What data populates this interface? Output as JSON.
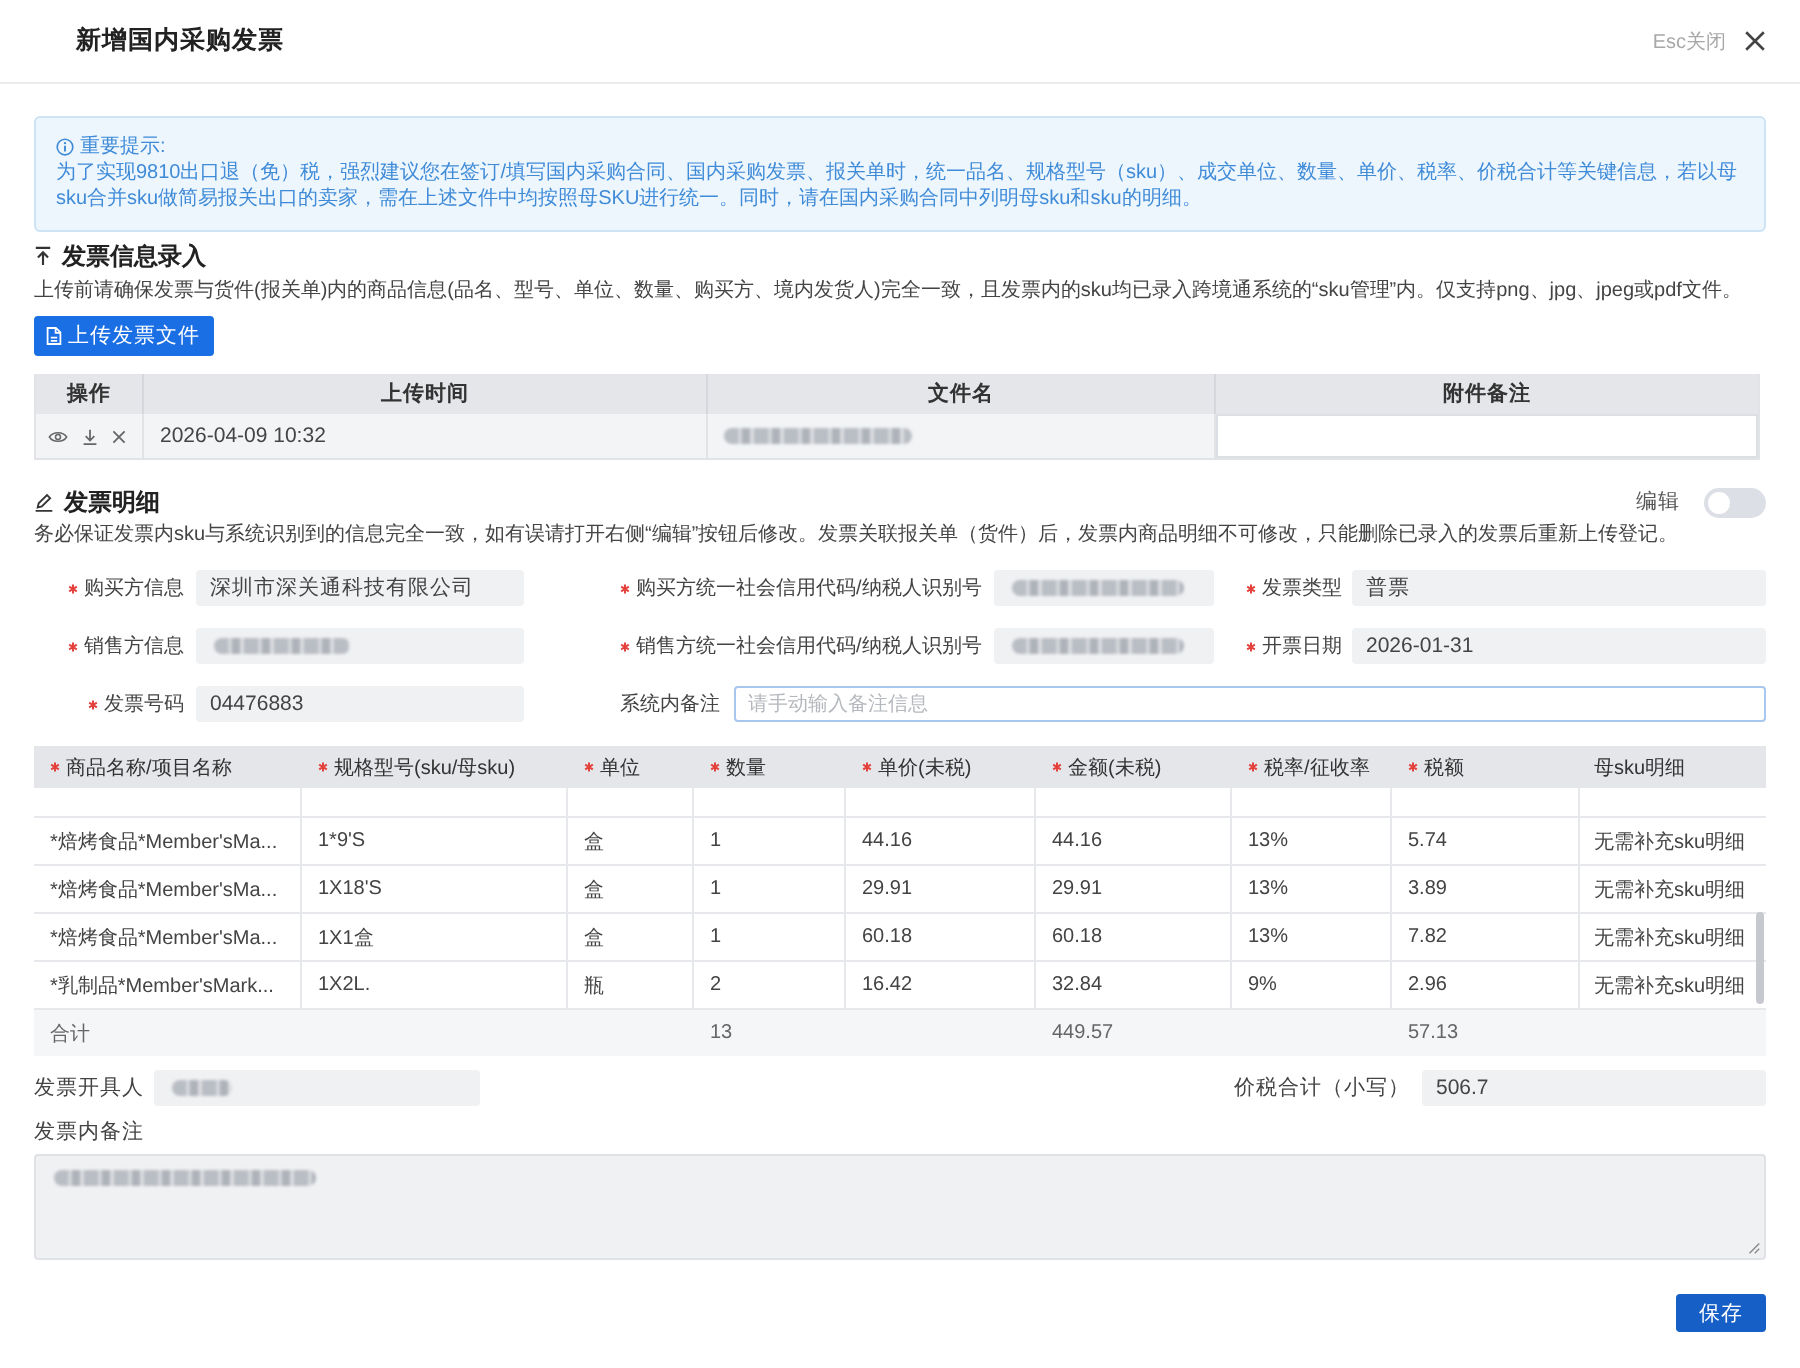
{
  "dialog": {
    "title": "新增国内采购发票",
    "close_hint": "Esc关闭"
  },
  "notice": {
    "title": "重要提示:",
    "text": "为了实现9810出口退（免）税，强烈建议您在签订/填写国内采购合同、国内采购发票、报关单时，统一品名、规格型号（sku）、成交单位、数量、单价、税率、价税合计等关键信息，若以母sku合并sku做简易报关出口的卖家，需在上述文件中均按照母SKU进行统一。同时，请在国内采购合同中列明母sku和sku的明细。"
  },
  "invoice_upload": {
    "heading": "发票信息录入",
    "description": "上传前请确保发票与货件(报关单)内的商品信息(品名、型号、单位、数量、购买方、境内发货人)完全一致，且发票内的sku均已录入跨境通系统的“sku管理”内。仅支持png、jpg、jpeg或pdf文件。",
    "upload_button": "上传发票文件",
    "table": {
      "columns": [
        "操作",
        "上传时间",
        "文件名",
        "附件备注"
      ],
      "rows": [
        {
          "upload_time": "2026-04-09 10:32",
          "file_name_blurred": true
        }
      ]
    }
  },
  "invoice_detail": {
    "heading": "发票明细",
    "edit_toggle": {
      "label": "编辑",
      "on": false
    },
    "description": "务必保证发票内sku与系统识别到的信息完全一致，如有误请打开右侧“编辑”按钮后修改。发票关联报关单（货件）后，发票内商品明细不可修改，只能删除已录入的发票后重新上传登记。",
    "field_rows": [
      {
        "fields": [
          {
            "kind": "readonly",
            "label": "购买方信息",
            "required": true,
            "value": "深圳市深关通科技有限公司"
          },
          {
            "kind": "readonly",
            "label": "购买方统一社会信用代码/纳税人识别号",
            "required": true,
            "blurred": true
          },
          {
            "kind": "readonly",
            "label": "发票类型",
            "required": true,
            "value": "普票"
          }
        ]
      },
      {
        "fields": [
          {
            "kind": "readonly",
            "label": "销售方信息",
            "required": true,
            "blurred": true
          },
          {
            "kind": "readonly",
            "label": "销售方统一社会信用代码/纳税人识别号",
            "required": true,
            "blurred": true
          },
          {
            "kind": "readonly",
            "label": "开票日期",
            "required": true,
            "value": "2026-01-31"
          }
        ]
      },
      {
        "fields": [
          {
            "kind": "readonly",
            "label": "发票号码",
            "required": true,
            "value": "04476883"
          },
          {
            "kind": "input",
            "label": "系统内备注",
            "required": false,
            "placeholder": "请手动输入备注信息"
          }
        ]
      }
    ],
    "items_table": {
      "columns": [
        {
          "label": "商品名称/项目名称",
          "required": true
        },
        {
          "label": "规格型号(sku/母sku)",
          "required": true
        },
        {
          "label": "单位",
          "required": true
        },
        {
          "label": "数量",
          "required": true
        },
        {
          "label": "单价(未税)",
          "required": true
        },
        {
          "label": "金额(未税)",
          "required": true
        },
        {
          "label": "税率/征收率",
          "required": true
        },
        {
          "label": "税额",
          "required": true
        },
        {
          "label": "母sku明细",
          "required": false
        }
      ],
      "rows": [
        {
          "cells": [
            "*焙烤食品*Member'sMa...",
            "1*9'S",
            "盒",
            "1",
            "44.16",
            "44.16",
            "13%",
            "5.74",
            "无需补充sku明细"
          ]
        },
        {
          "cells": [
            "*焙烤食品*Member'sMa...",
            "1X18'S",
            "盒",
            "1",
            "29.91",
            "29.91",
            "13%",
            "3.89",
            "无需补充sku明细"
          ]
        },
        {
          "cells": [
            "*焙烤食品*Member'sMa...",
            "1X1盒",
            "盒",
            "1",
            "60.18",
            "60.18",
            "13%",
            "7.82",
            "无需补充sku明细"
          ]
        },
        {
          "cells": [
            "*乳制品*Member'sMark...",
            "1X2L.",
            "瓶",
            "2",
            "16.42",
            "32.84",
            "9%",
            "2.96",
            "无需补充sku明细"
          ]
        }
      ],
      "total": {
        "label": "合计",
        "quantity": "13",
        "amount": "449.57",
        "tax": "57.13"
      }
    }
  },
  "footer": {
    "issuer": {
      "label": "发票开具人",
      "blurred": true
    },
    "total_with_tax": {
      "label": "价税合计（小写）",
      "value": "506.7"
    },
    "remark": {
      "label": "发票内备注",
      "blurred": true
    },
    "save_button": "保存"
  }
}
